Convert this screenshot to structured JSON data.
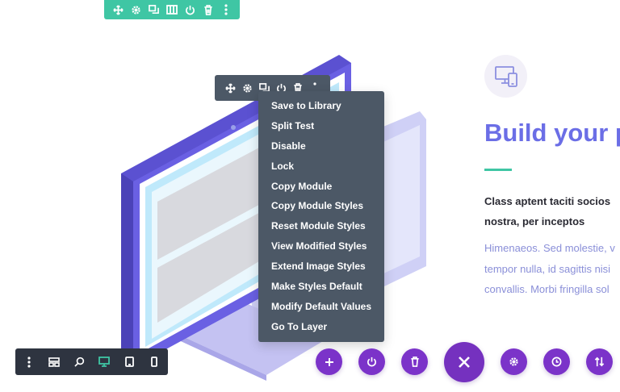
{
  "section_toolbar": {
    "icons": [
      "move-icon",
      "gear-icon",
      "duplicate-icon",
      "columns-icon",
      "power-icon",
      "trash-icon",
      "more-vertical-icon"
    ],
    "color": "#3fc6a4"
  },
  "module_toolbar": {
    "icons": [
      "move-icon",
      "gear-icon",
      "duplicate-icon",
      "power-icon",
      "trash-icon",
      "more-vertical-icon"
    ],
    "color": "#4c5866"
  },
  "context_menu": {
    "items": [
      "Save to Library",
      "Split Test",
      "Disable",
      "Lock",
      "Copy Module",
      "Copy Module Styles",
      "Reset Module Styles",
      "View Modified Styles",
      "Extend Image Styles",
      "Make Styles Default",
      "Modify Default Values",
      "Go To Layer"
    ]
  },
  "content": {
    "heading": "Build your p",
    "intro_line1": "Class aptent taciti socios",
    "intro_line2": "nostra, per inceptos",
    "body_line1": "Himenaeos. Sed molestie, v",
    "body_line2": "tempor nulla, id sagittis nisi",
    "body_line3": "convallis. Morbi fringilla sol",
    "heading_color": "#6b6ee6",
    "accent_color": "#3fc6a4",
    "feature_icon": "devices-icon"
  },
  "view_toolbar": {
    "icons": [
      "more-vertical-icon",
      "layout-icon",
      "zoom-icon",
      "desktop-icon",
      "tablet-icon",
      "phone-icon"
    ],
    "active": "desktop-icon"
  },
  "action_bar": {
    "icons": [
      "plus-icon",
      "power-icon",
      "trash-icon",
      "close-icon",
      "gear-icon",
      "history-icon",
      "sort-icon"
    ],
    "color": "#7b33c9"
  }
}
